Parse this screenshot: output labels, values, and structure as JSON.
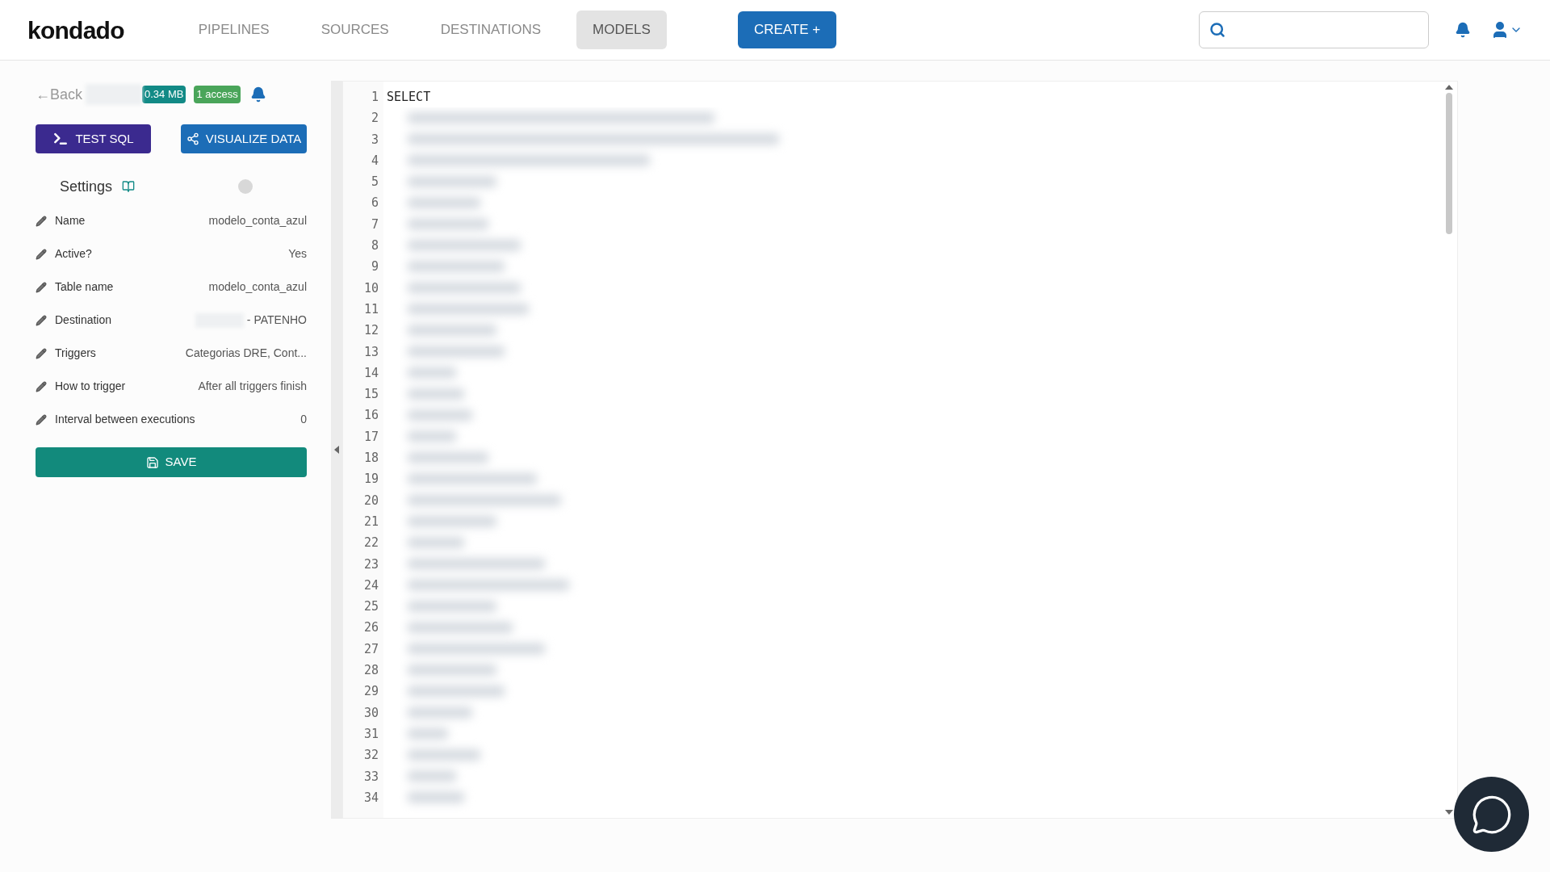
{
  "nav": {
    "logo": "kondado",
    "items": [
      {
        "label": "PIPELINES",
        "selected": false
      },
      {
        "label": "SOURCES",
        "selected": false
      },
      {
        "label": "DESTINATIONS",
        "selected": false
      },
      {
        "label": "MODELS",
        "selected": true
      }
    ],
    "create": "CREATE +"
  },
  "header": {
    "back": "←Back",
    "size": "0.34 MB",
    "access": "1 access"
  },
  "buttons": {
    "test": "TEST SQL",
    "visualize": "VISUALIZE DATA",
    "save": "SAVE"
  },
  "settings": {
    "title": "Settings",
    "rows": [
      {
        "label": "Name",
        "value": "modelo_conta_azul"
      },
      {
        "label": "Active?",
        "value": "Yes"
      },
      {
        "label": "Table name",
        "value": "modelo_conta_azul"
      },
      {
        "label": "Destination",
        "value": "- PATENHO"
      },
      {
        "label": "Triggers",
        "value": "Categorias DRE, Cont..."
      },
      {
        "label": "How to trigger",
        "value": "After all triggers finish"
      },
      {
        "label": "Interval between executions",
        "value": "0"
      }
    ]
  },
  "editor": {
    "first_line": "SELECT",
    "line_numbers": [
      "1",
      "2",
      "3",
      "4",
      "5",
      "6",
      "7",
      "8",
      "9",
      "10",
      "11",
      "12",
      "13",
      "14",
      "15",
      "16",
      "17",
      "18",
      "19",
      "20",
      "21",
      "22",
      "23",
      "24",
      "25",
      "26",
      "27",
      "28",
      "29",
      "30",
      "31",
      "32",
      "33",
      "34"
    ]
  }
}
